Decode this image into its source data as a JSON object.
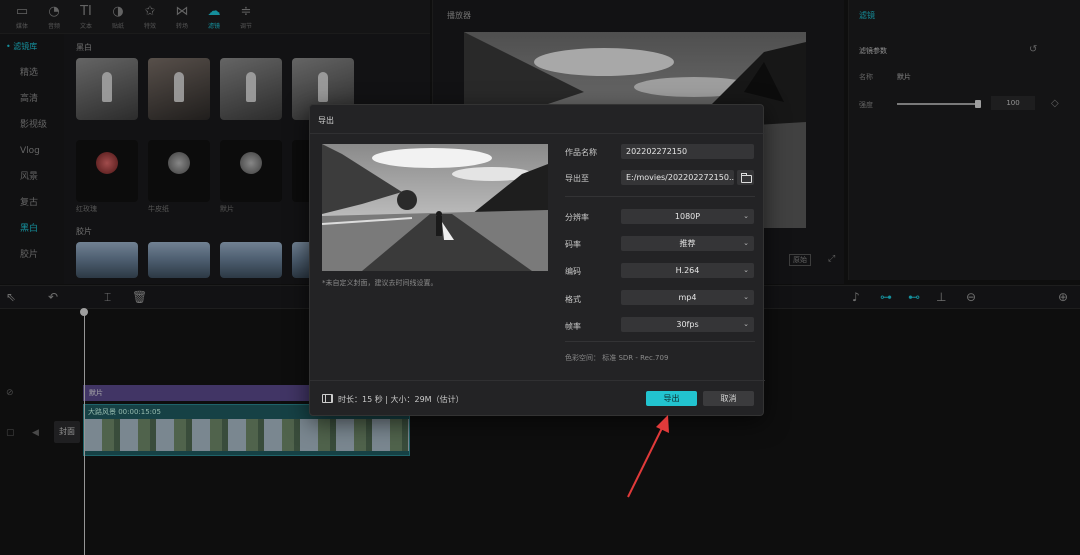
{
  "toolbar": {
    "items": [
      {
        "label": "媒体",
        "icon": "media-icon"
      },
      {
        "label": "音频",
        "icon": "audio-icon"
      },
      {
        "label": "文本",
        "icon": "text-icon",
        "glyph": "TI"
      },
      {
        "label": "贴纸",
        "icon": "sticker-icon"
      },
      {
        "label": "特效",
        "icon": "effects-icon"
      },
      {
        "label": "转场",
        "icon": "transition-icon"
      },
      {
        "label": "滤镜",
        "icon": "filter-icon"
      },
      {
        "label": "调节",
        "icon": "adjust-icon"
      }
    ],
    "active_index": 6
  },
  "sidebar": {
    "items": [
      "• 滤镜库",
      "精选",
      "高清",
      "影视级",
      "Vlog",
      "风景",
      "复古",
      "黑白",
      "胶片"
    ],
    "selected_index": 7
  },
  "library": {
    "section1": "黑白",
    "section2": "胶片",
    "thumbs_row2": [
      "红玫瑰",
      "牛皮纸",
      "默片"
    ]
  },
  "player": {
    "title": "播放器",
    "ctrl_label": "原始"
  },
  "props": {
    "tab": "滤镜",
    "section": "滤镜参数",
    "name_label": "名称",
    "name_value": "默片",
    "strength_label": "强度",
    "strength_value": "100",
    "strength_fraction": 1.0
  },
  "timeline": {
    "filter_clip": "默片",
    "video_clip_label": "大路风景  00:00:15:05",
    "cover_label": "封面"
  },
  "dialog": {
    "title": "导出",
    "hint": "*未自定义封面，建议去时间线设置。",
    "fields": {
      "name_label": "作品名称",
      "name_value": "202202272150",
      "path_label": "导出至",
      "path_value": "E:/movies/202202272150..."
    },
    "selects": [
      {
        "label": "分辨率",
        "value": "1080P"
      },
      {
        "label": "码率",
        "value": "推荐"
      },
      {
        "label": "编码",
        "value": "H.264"
      },
      {
        "label": "格式",
        "value": "mp4"
      },
      {
        "label": "帧率",
        "value": "30fps"
      }
    ],
    "colorspace": "色彩空间：  标准 SDR - Rec.709",
    "footer_info": "时长：15 秒  |  大小：29M（估计）",
    "export_button": "导出",
    "cancel_button": "取消"
  }
}
